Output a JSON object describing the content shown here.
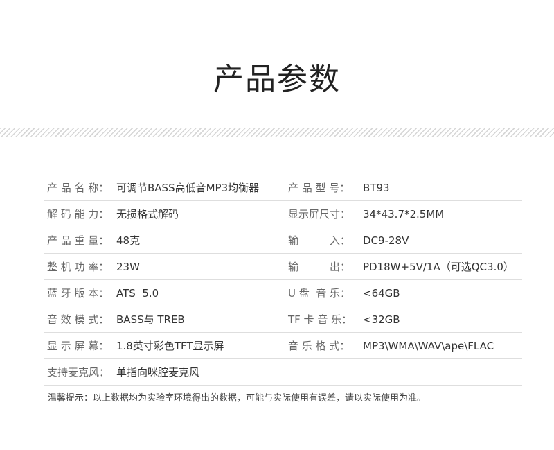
{
  "header": {
    "title": "产品参数"
  },
  "specs": [
    {
      "l_label": "产 品 名 称：",
      "l_value": "可调节BASS高低音MP3均衡器",
      "r_label": "产 品 型 号：",
      "r_value": "BT93"
    },
    {
      "l_label": "解 码 能 力：",
      "l_value": "无损格式解码",
      "r_label": "显示屏尺寸：",
      "r_value": "34*43.7*2.5MM"
    },
    {
      "l_label": "产 品 重 量：",
      "l_value": "48克",
      "r_label": "输　　　入：",
      "r_value": "DC9-28V"
    },
    {
      "l_label": "整 机 功 率：",
      "l_value": "23W",
      "r_label": "输　　　出：",
      "r_value": "PD18W+5V/1A（可选QC3.0）"
    },
    {
      "l_label": "蓝 牙 版 本：",
      "l_value": "ATS  5.0",
      "r_label": "U 盘  音 乐：",
      "r_value": "<64GB"
    },
    {
      "l_label": "音 效 模 式：",
      "l_value": "BASS与 TREB",
      "r_label": "TF 卡 音 乐：",
      "r_value": "<32GB"
    },
    {
      "l_label": "显 示 屏 幕：",
      "l_value": "1.8英寸彩色TFT显示屏",
      "r_label": "音 乐 格 式：",
      "r_value": "MP3\\WMA\\WAV\\ape\\FLAC"
    },
    {
      "l_label": "支持麦克风：",
      "l_value": "单指向咪腔麦克风",
      "r_label": "",
      "r_value": ""
    }
  ],
  "footer": {
    "note": "温馨提示：以上数据均为实验室环境得出的数据，可能与实际使用有误差，请以实际使用为准。"
  }
}
